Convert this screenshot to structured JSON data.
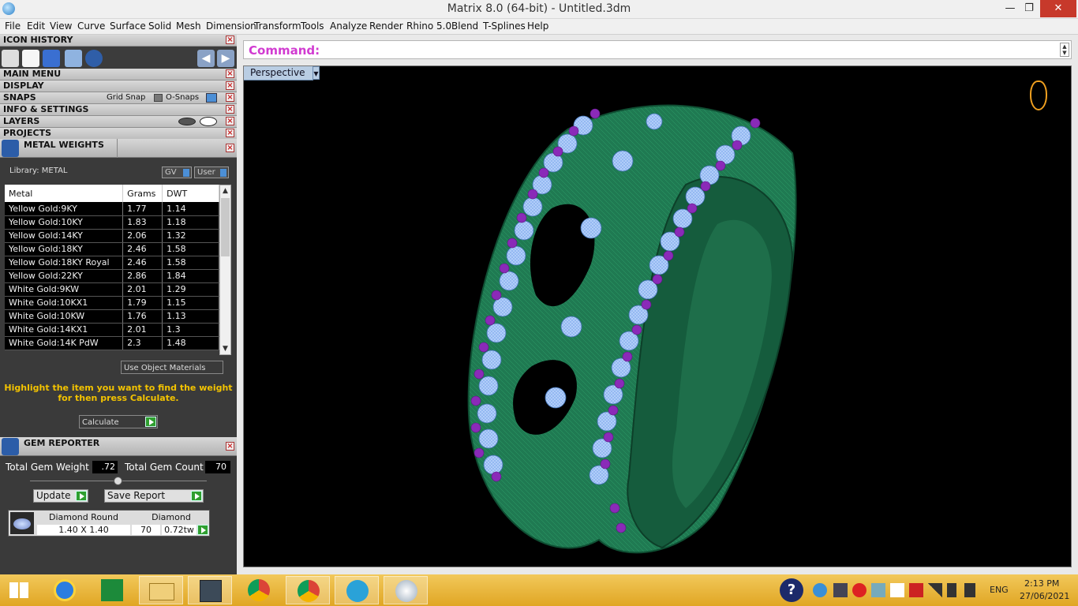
{
  "window": {
    "title": "Matrix 8.0 (64-bit) - Untitled.3dm"
  },
  "menu": [
    "File",
    "Edit",
    "View",
    "Curve",
    "Surface",
    "Solid",
    "Mesh",
    "Dimension",
    "Transform",
    "Tools",
    "Analyze",
    "Render",
    "Rhino 5.0",
    "Blend",
    "T-Splines",
    "Help"
  ],
  "panels": {
    "icon_history": "ICON HISTORY",
    "main_menu": "MAIN MENU",
    "display": "DISPLAY",
    "snaps": "SNAPS",
    "grid_snap": "Grid Snap",
    "o_snaps": "O-Snaps",
    "info_settings": "INFO & SETTINGS",
    "layers": "LAYERS",
    "projects": "PROJECTS"
  },
  "metal_weights": {
    "title": "METAL WEIGHTS",
    "library_label": "Library: METAL",
    "gv_label": "GV",
    "user_label": "User",
    "columns": [
      "Metal",
      "Grams",
      "DWT"
    ],
    "rows": [
      [
        "Yellow Gold:9KY",
        "1.77",
        "1.14"
      ],
      [
        "Yellow Gold:10KY",
        "1.83",
        "1.18"
      ],
      [
        "Yellow Gold:14KY",
        "2.06",
        "1.32"
      ],
      [
        "Yellow Gold:18KY",
        "2.46",
        "1.58"
      ],
      [
        "Yellow Gold:18KY Royal",
        "2.46",
        "1.58"
      ],
      [
        "Yellow Gold:22KY",
        "2.86",
        "1.84"
      ],
      [
        "White Gold:9KW",
        "2.01",
        "1.29"
      ],
      [
        "White Gold:10KX1",
        "1.79",
        "1.15"
      ],
      [
        "White Gold:10KW",
        "1.76",
        "1.13"
      ],
      [
        "White Gold:14KX1",
        "2.01",
        "1.3"
      ],
      [
        "White Gold:14K PdW",
        "2.3",
        "1.48"
      ]
    ],
    "use_object_materials": "Use Object Materials",
    "hint_line1": "Highlight the item you want to find the weight",
    "hint_line2": "for then press Calculate.",
    "calculate_label": "Calculate"
  },
  "gem_reporter": {
    "title": "GEM REPORTER",
    "total_weight_label": "Total Gem Weight",
    "total_weight_value": ".72",
    "total_count_label": "Total Gem Count",
    "total_count_value": "70",
    "update_label": "Update",
    "save_report_label": "Save Report",
    "gem_name": "Diamond Round",
    "gem_type": "Diamond",
    "gem_size": "1.40 X 1.40",
    "gem_count": "70",
    "gem_tw": "0.72tw"
  },
  "command": {
    "label": "Command:"
  },
  "viewport": {
    "name": "Perspective"
  },
  "taskbar": {
    "language": "ENG",
    "time": "2:13 PM",
    "date": "27/06/2021"
  },
  "colors": {
    "metal": "#1f7a52",
    "gem": "#8fb6f0",
    "prong": "#8a2ab8",
    "command_label": "#d13bd1",
    "taskbar": "#e8b43a"
  }
}
